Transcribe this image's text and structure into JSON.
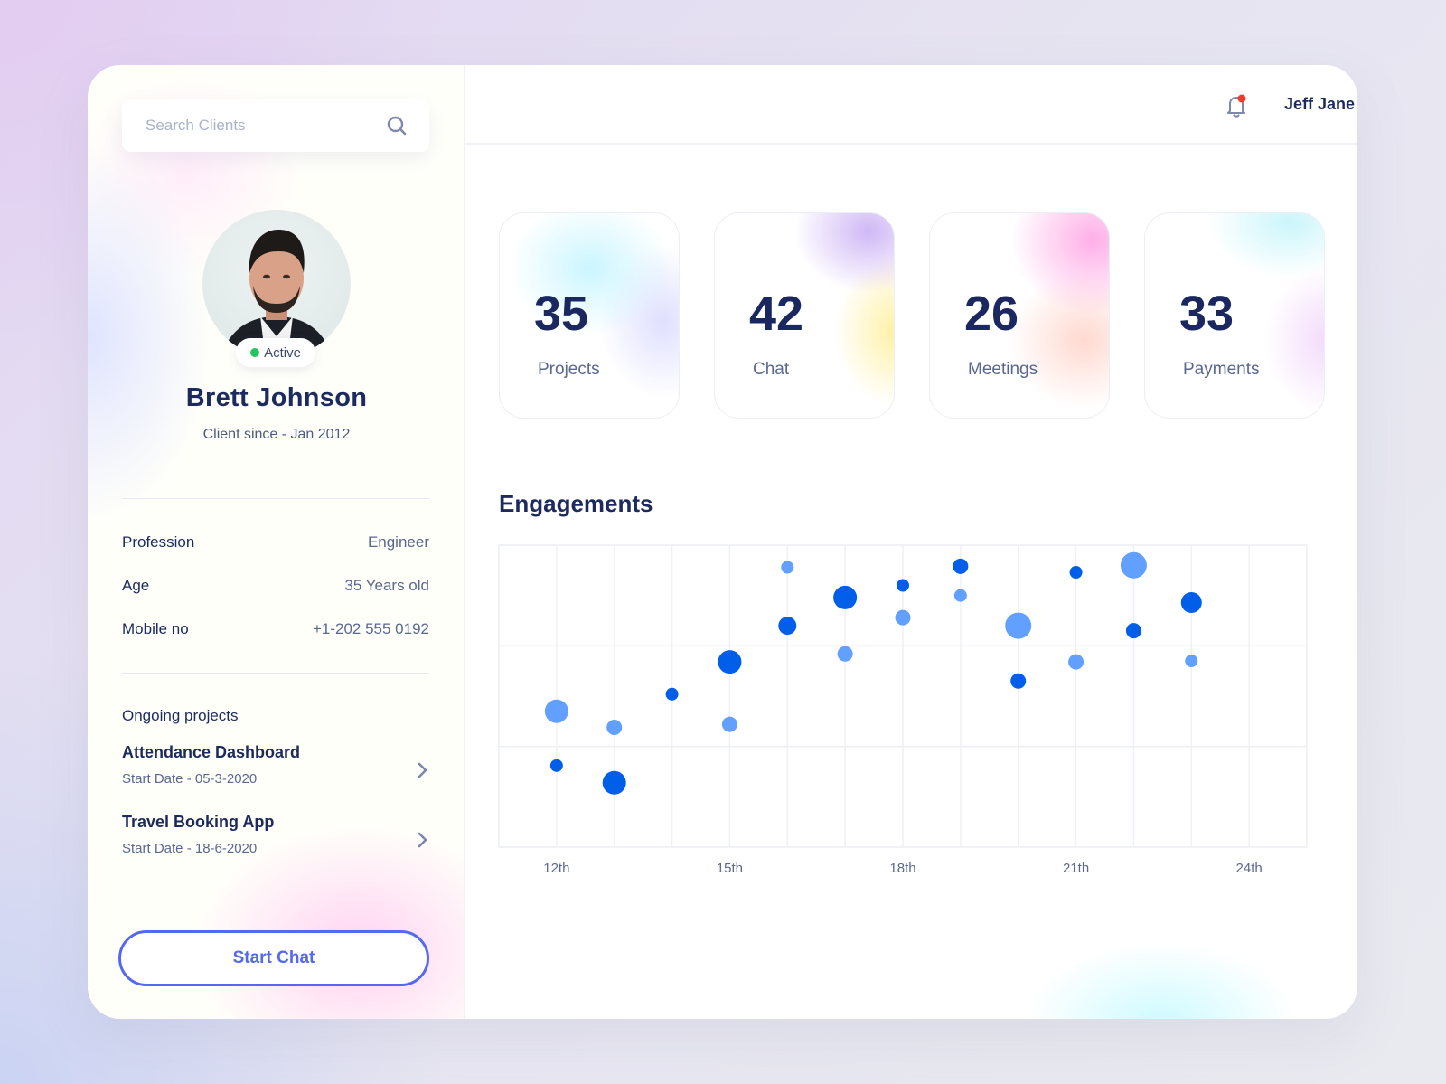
{
  "sidebar": {
    "search": {
      "placeholder": "Search Clients",
      "value": "",
      "icon": "search-icon"
    },
    "client": {
      "name": "Brett Johnson",
      "since": "Client since - Jan 2012",
      "status": "Active",
      "status_color": "#22c55e"
    },
    "info": [
      {
        "label": "Profession",
        "value": "Engineer"
      },
      {
        "label": "Age",
        "value": "35 Years old"
      },
      {
        "label": "Mobile no",
        "value": "+1-202 555 0192"
      }
    ],
    "projects_title": "Ongoing projects",
    "projects": [
      {
        "name": "Attendance Dashboard",
        "start": "Start Date - 05-3-2020"
      },
      {
        "name": "Travel Booking App",
        "start": "Start Date - 18-6-2020"
      }
    ],
    "start_chat_label": "Start Chat",
    "accent": "#5568f0"
  },
  "topbar": {
    "user_name": "Jeff Jane",
    "notification_icon": "bell-icon",
    "has_notification": true,
    "notification_color": "#ef3b2d"
  },
  "stats": [
    {
      "value": "35",
      "label": "Projects"
    },
    {
      "value": "42",
      "label": "Chat"
    },
    {
      "value": "26",
      "label": "Meetings"
    },
    {
      "value": "33",
      "label": "Payments"
    }
  ],
  "chart_data": {
    "type": "scatter",
    "title": "Engagements",
    "xlabel": "",
    "ylabel": "",
    "x_tick_labels": [
      {
        "x": 12,
        "label": "12th"
      },
      {
        "x": 15,
        "label": "15th"
      },
      {
        "x": 18,
        "label": "18th"
      },
      {
        "x": 21,
        "label": "21th"
      },
      {
        "x": 24,
        "label": "24th"
      }
    ],
    "xlim": [
      11,
      25
    ],
    "ylim": [
      0,
      3
    ],
    "grid": true,
    "series": [
      {
        "name": "dark",
        "color": "#005ee8",
        "points": [
          {
            "x": 12,
            "y": 0.81,
            "size": 1
          },
          {
            "x": 13,
            "y": 0.64,
            "size": 3
          },
          {
            "x": 14,
            "y": 1.52,
            "size": 1
          },
          {
            "x": 15,
            "y": 1.84,
            "size": 3
          },
          {
            "x": 16,
            "y": 2.2,
            "size": 2
          },
          {
            "x": 17,
            "y": 2.48,
            "size": 3
          },
          {
            "x": 18,
            "y": 2.6,
            "size": 1
          },
          {
            "x": 19,
            "y": 2.79,
            "size": 1.5
          },
          {
            "x": 20,
            "y": 1.65,
            "size": 1.5
          },
          {
            "x": 21,
            "y": 2.73,
            "size": 1
          },
          {
            "x": 22,
            "y": 2.15,
            "size": 1.5
          },
          {
            "x": 23,
            "y": 2.43,
            "size": 2.5
          }
        ]
      },
      {
        "name": "light",
        "color": "#62a0ff",
        "points": [
          {
            "x": 12,
            "y": 1.35,
            "size": 3
          },
          {
            "x": 13,
            "y": 1.19,
            "size": 1.5
          },
          {
            "x": 15,
            "y": 1.22,
            "size": 1.5
          },
          {
            "x": 16,
            "y": 2.78,
            "size": 1
          },
          {
            "x": 17,
            "y": 1.92,
            "size": 1.5
          },
          {
            "x": 18,
            "y": 2.28,
            "size": 1.5
          },
          {
            "x": 19,
            "y": 2.5,
            "size": 1
          },
          {
            "x": 20,
            "y": 2.2,
            "size": 3.5
          },
          {
            "x": 21,
            "y": 1.84,
            "size": 1.5
          },
          {
            "x": 22,
            "y": 2.8,
            "size": 3.5
          },
          {
            "x": 23,
            "y": 1.85,
            "size": 1
          }
        ]
      }
    ]
  }
}
